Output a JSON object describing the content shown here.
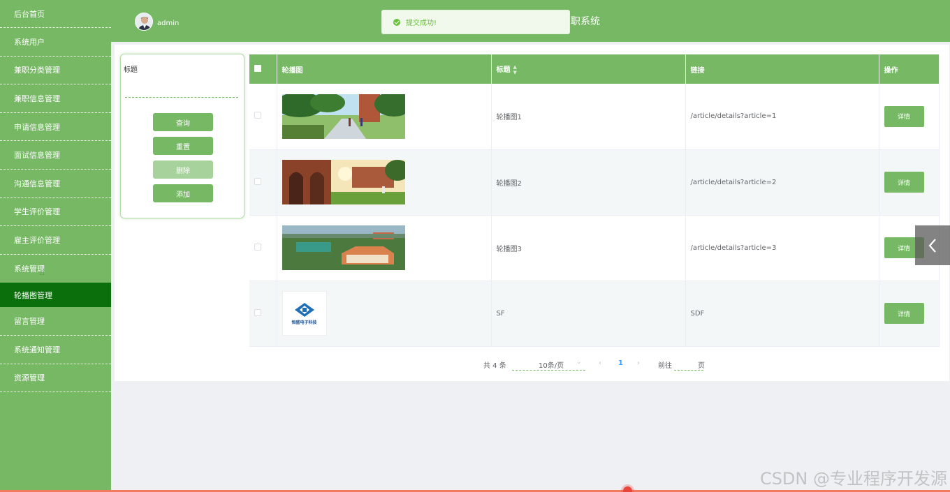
{
  "sidebar": {
    "items": [
      {
        "label": "后台首页"
      },
      {
        "label": "系统用户"
      },
      {
        "label": "兼职分类管理"
      },
      {
        "label": "兼职信息管理"
      },
      {
        "label": "申请信息管理"
      },
      {
        "label": "面试信息管理"
      },
      {
        "label": "沟通信息管理"
      },
      {
        "label": "学生评价管理"
      },
      {
        "label": "雇主评价管理"
      },
      {
        "label": "系统管理"
      },
      {
        "label": "轮播图管理"
      },
      {
        "label": "留言管理"
      },
      {
        "label": "系统通知管理"
      },
      {
        "label": "资源管理"
      }
    ],
    "active_index": 10
  },
  "header": {
    "username": "admin",
    "title_fragment": "职系统"
  },
  "toast": {
    "message": "提交成功!"
  },
  "search": {
    "label": "标题",
    "value": "",
    "buttons": {
      "query": "查询",
      "reset": "重置",
      "delete": "删除",
      "add": "添加"
    }
  },
  "table": {
    "headers": {
      "image": "轮播图",
      "title": "标题",
      "link": "链接",
      "action": "操作"
    },
    "rows": [
      {
        "title": "轮播图1",
        "link": "/article/details?article=1",
        "action": "详情",
        "image": "campus-path-trees"
      },
      {
        "title": "轮播图2",
        "link": "/article/details?article=2",
        "action": "详情",
        "image": "campus-arches-fountain"
      },
      {
        "title": "轮播图3",
        "link": "/article/details?article=3",
        "action": "详情",
        "image": "campus-aerial-view"
      },
      {
        "title": "SF",
        "link": "SDF",
        "action": "详情",
        "image": "company-logo"
      }
    ]
  },
  "logo_text": "恒盛电子科技",
  "pagination": {
    "total": "共 4 条",
    "page_size": "10条/页",
    "current_page": "1",
    "goto_label": "前往",
    "page_unit": "页"
  },
  "watermark": "CSDN @专业程序开发源",
  "colors": {
    "primary": "#77b865",
    "active": "#0b6f0b",
    "toast_bg": "#f0f9eb",
    "toast_text": "#67c23a"
  }
}
